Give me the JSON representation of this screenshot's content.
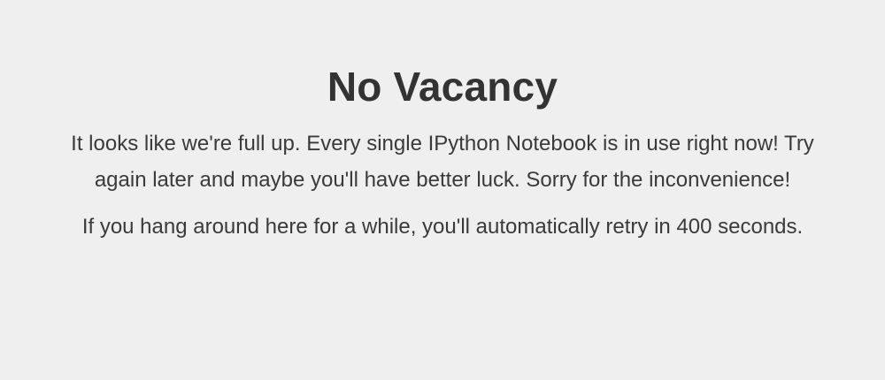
{
  "page": {
    "title": "No Vacancy",
    "message": "It looks like we're full up. Every single IPython Notebook is in use right now! Try again later and maybe you'll have better luck. Sorry for the inconvenience!",
    "retry_text": "If you hang around here for a while, you'll automatically retry in 400 seconds."
  },
  "colors": {
    "background": "#f0efef",
    "text": "#333333"
  }
}
